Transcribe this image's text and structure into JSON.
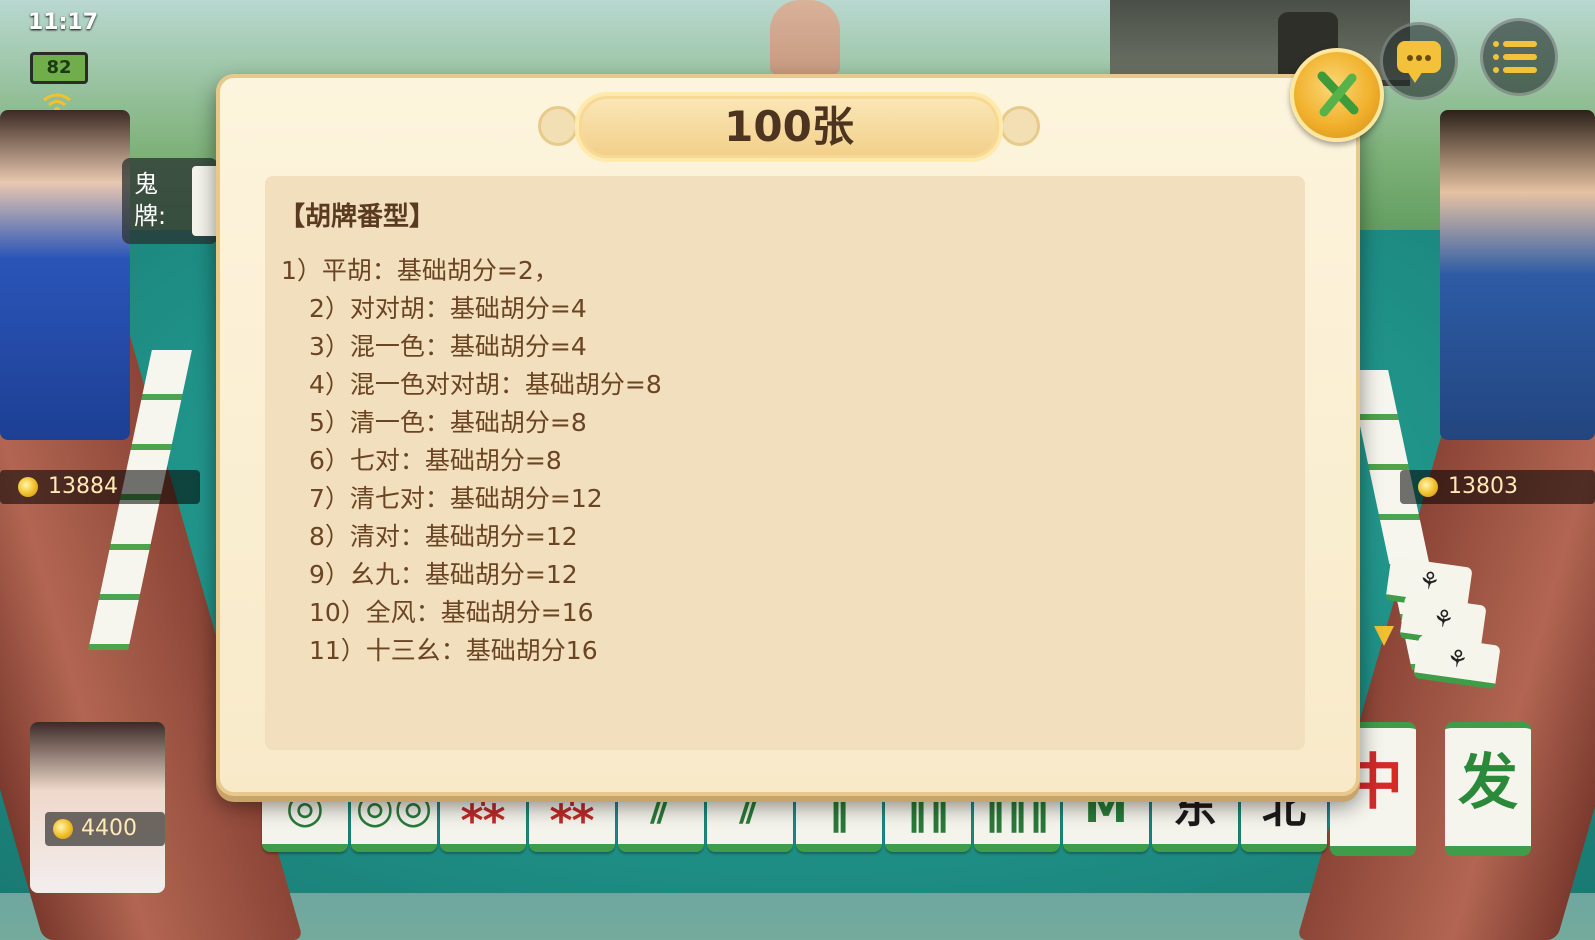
{
  "status": {
    "time": "11:17",
    "battery": "82"
  },
  "ghost": {
    "label": "鬼牌:"
  },
  "players": {
    "left": {
      "score": "13884"
    },
    "right": {
      "score": "13803"
    },
    "self": {
      "score": "4400"
    }
  },
  "modal": {
    "title": "100张",
    "heading": "【胡牌番型】",
    "rules": [
      "1）平胡：基础胡分=2，",
      "2）对对胡：基础胡分=4",
      "3）混一色：基础胡分=4",
      "4）混一色对对胡：基础胡分=8",
      "5）清一色：基础胡分=8",
      "6）七对：基础胡分=8",
      "7）清七对：基础胡分=12",
      "8）清对：基础胡分=12",
      "9）幺九：基础胡分=12",
      "10）全风：基础胡分=16",
      "11）十三幺：基础胡分16"
    ]
  },
  "hand": {
    "tiles": [
      "◎",
      "◎◎",
      "⁂",
      "⁂",
      "⫽",
      "⫽",
      "‖",
      "‖‖",
      "‖‖‖",
      "M",
      "东",
      "北"
    ],
    "hu_tile": "中",
    "draw_tile": "发"
  },
  "colors": {
    "accent": "#f1b12c",
    "felt": "#1f9187",
    "text": "#6b4422"
  }
}
